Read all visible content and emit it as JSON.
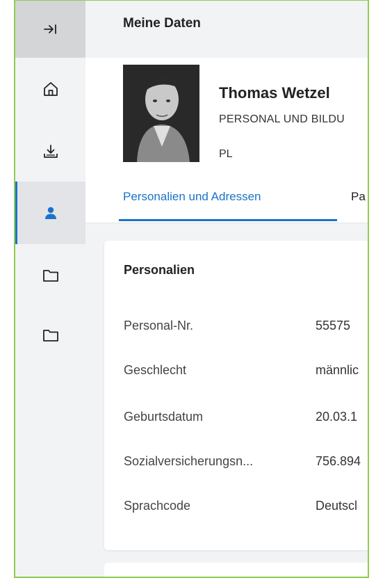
{
  "sidebar": {
    "collapse_icon": "arrow-right-to-bar-icon",
    "items": [
      {
        "name": "home",
        "icon": "home-icon",
        "active": false
      },
      {
        "name": "download",
        "icon": "download-tray-icon",
        "active": false
      },
      {
        "name": "profile",
        "icon": "person-icon",
        "active": true
      },
      {
        "name": "folder-1",
        "icon": "folder-icon",
        "active": false
      },
      {
        "name": "folder-2",
        "icon": "folder-icon",
        "active": false
      }
    ]
  },
  "header": {
    "title": "Meine Daten"
  },
  "profile": {
    "name": "Thomas Wetzel",
    "department": "PERSONAL UND BILDU",
    "code": "PL"
  },
  "tabs": [
    {
      "label": "Personalien und Adressen",
      "active": true
    },
    {
      "label": "Pa",
      "active": false
    }
  ],
  "personalien": {
    "title": "Personalien",
    "rows": [
      {
        "label": "Personal-Nr.",
        "value": "55575"
      },
      {
        "label": "Geschlecht",
        "value": "männlic"
      },
      {
        "label": "Geburtsdatum",
        "value": "20.03.1"
      },
      {
        "label": "Sozialversicherungsn...",
        "value": "756.894"
      },
      {
        "label": "Sprachcode",
        "value": "Deutscl"
      }
    ]
  },
  "colors": {
    "accent": "#1a73c9",
    "sidebar_bg": "#f2f3f5",
    "frame_border": "#8fcc4f"
  }
}
